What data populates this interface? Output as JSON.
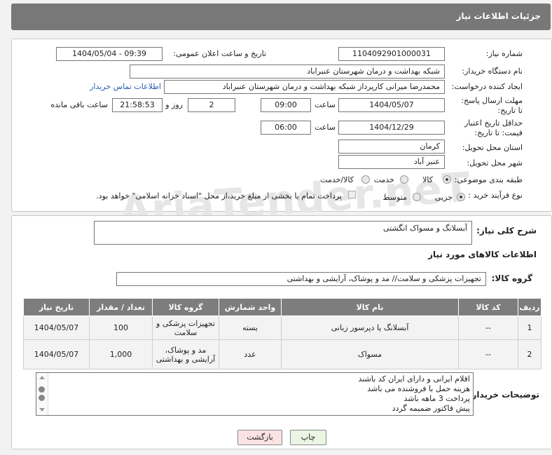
{
  "page_title": "جزئیات اطلاعات نیاز",
  "watermark": "AriaTender.neT",
  "fields": {
    "need_number_label": "شماره نیاز:",
    "need_number": "1104092901000031",
    "announce_label": "تاریخ و ساعت اعلان عمومی:",
    "announce_value": "1404/05/04 - 09:39",
    "buyer_org_label": "نام دستگاه خریدار:",
    "buyer_org": "شبکه بهداشت و درمان شهرستان عنبراباد",
    "creator_label": "ایجاد کننده درخواست:",
    "creator": "محمدرضا میرانی کارپرداز  شبکه بهداشت و درمان شهرستان عنبراباد",
    "contact_link": "اطلاعات تماس خریدار",
    "send_deadline_label": "مهلت ارسال پاسخ: تا تاریخ:",
    "send_date": "1404/05/07",
    "time_label": "ساعت",
    "send_time": "09:00",
    "days_value": "2",
    "days_label": "روز و",
    "remaining_time": "21:58:53",
    "remaining_label": "ساعت باقی مانده",
    "price_deadline_label": "حداقل تاریخ اعتبار قیمت: تا تاریخ:",
    "price_date": "1404/12/29",
    "price_time": "06:00",
    "province_label": "استان محل تحویل:",
    "province": "کرمان",
    "city_label": "شهر محل تحویل:",
    "city": "عنبر آباد",
    "category_label": "طبقه بندی موضوعی:",
    "category_options": [
      "کالا",
      "خدمت",
      "کالا/خدمت"
    ],
    "purchase_type_label": "نوع فرآیند خرید :",
    "purchase_options": [
      "جزیی",
      "متوسط"
    ],
    "payment_note": "پرداخت تمام یا بخشی از مبلغ خرید،از محل \"اسناد خزانه اسلامی\" خواهد بود."
  },
  "description": {
    "label": "شرح کلی نیاز:",
    "value": "آبسلانگ و مسواک انگشتی"
  },
  "goods": {
    "section_title": "اطلاعات کالاهای مورد نیاز",
    "group_label": "گروه کالا:",
    "group_value": "تجهیزات پزشکی و سلامت// مد و پوشاک، آرایشی و بهداشتی",
    "columns": [
      "ردیف",
      "کد کالا",
      "نام کالا",
      "واحد شمارش",
      "گروه کالا",
      "تعداد / مقدار",
      "تاریخ نیاز"
    ],
    "rows": [
      {
        "row": "1",
        "code": "--",
        "name": "آبسلانگ یا دپرسور زبانی",
        "unit": "بسته",
        "group": "تجهیزات پزشکی و سلامت",
        "qty": "100",
        "date": "1404/05/07"
      },
      {
        "row": "2",
        "code": "--",
        "name": "مسواک",
        "unit": "عدد",
        "group": "مد و پوشاک، آرایشی و بهداشتی",
        "qty": "1,000",
        "date": "1404/05/07"
      }
    ]
  },
  "buyer_notes": {
    "label": "توضیحات خریدار:",
    "lines": [
      "اقلام ایرانی و دارای ایران کد باشند",
      "هزینه حمل با فروشنده می باشد",
      "پرداخت 3 ماهه باشد",
      "پیش فاکتور ضمیمه گردد"
    ]
  },
  "buttons": {
    "print": "چاپ",
    "back": "بازگشت"
  }
}
